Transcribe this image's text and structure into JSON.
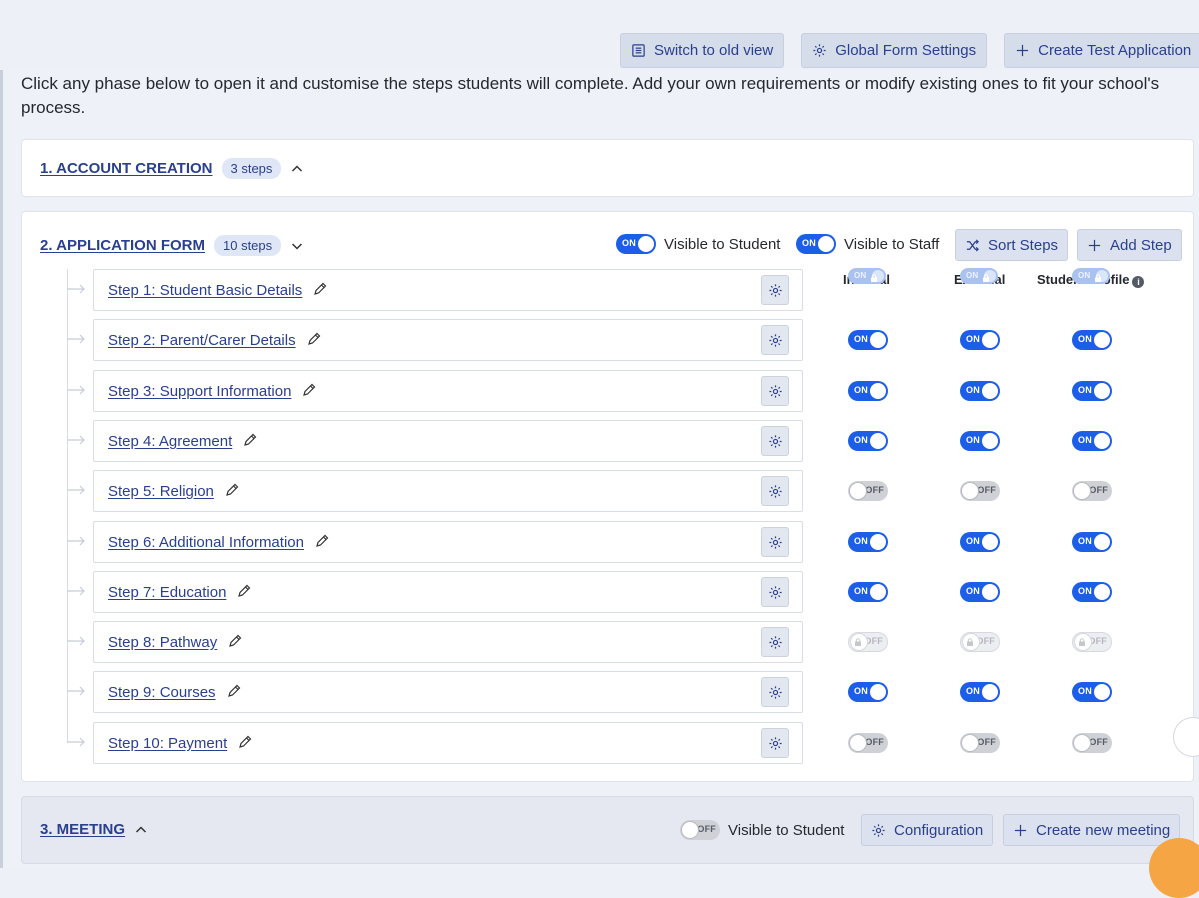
{
  "toolbar": {
    "switch_old_view": "Switch to old view",
    "global_form_settings": "Global Form Settings",
    "create_test_application": "Create Test Application"
  },
  "intro": "Click any phase below to open it and customise the steps students will complete. Add your own requirements or modify existing ones to fit your school's process.",
  "phase1": {
    "title": "1. ACCOUNT CREATION",
    "steps_badge": "3 steps"
  },
  "phase2": {
    "title": "2. APPLICATION FORM",
    "steps_badge": "10 steps",
    "visible_to_student": "Visible to Student",
    "visible_to_student_toggle": "ON",
    "visible_to_staff": "Visible to Staff",
    "visible_to_staff_toggle": "ON",
    "sort_steps": "Sort Steps",
    "add_step": "Add Step",
    "columns": {
      "internal": "Internal",
      "external": "External",
      "student_profile": "Student Profile"
    },
    "steps": [
      {
        "label": "Step 1: Student Basic Details",
        "internal": "ON",
        "external": "ON",
        "profile": "ON",
        "state": "locked"
      },
      {
        "label": "Step 2: Parent/Carer Details",
        "internal": "ON",
        "external": "ON",
        "profile": "ON",
        "state": "on"
      },
      {
        "label": "Step 3: Support Information",
        "internal": "ON",
        "external": "ON",
        "profile": "ON",
        "state": "on"
      },
      {
        "label": "Step 4: Agreement",
        "internal": "ON",
        "external": "ON",
        "profile": "ON",
        "state": "on"
      },
      {
        "label": "Step 5: Religion",
        "internal": "OFF",
        "external": "OFF",
        "profile": "OFF",
        "state": "off"
      },
      {
        "label": "Step 6: Additional Information",
        "internal": "ON",
        "external": "ON",
        "profile": "ON",
        "state": "on"
      },
      {
        "label": "Step 7: Education",
        "internal": "ON",
        "external": "ON",
        "profile": "ON",
        "state": "on"
      },
      {
        "label": "Step 8: Pathway",
        "internal": "OFF",
        "external": "OFF",
        "profile": "OFF",
        "state": "lockedoff"
      },
      {
        "label": "Step 9: Courses",
        "internal": "ON",
        "external": "ON",
        "profile": "ON",
        "state": "on"
      },
      {
        "label": "Step 10: Payment",
        "internal": "OFF",
        "external": "OFF",
        "profile": "OFF",
        "state": "off"
      }
    ]
  },
  "phase3": {
    "title": "3. MEETING",
    "visible_to_student": "Visible to Student",
    "visible_to_student_toggle": "OFF",
    "configuration": "Configuration",
    "create_new_meeting": "Create new meeting"
  },
  "colors": {
    "primary": "#2a3f8f",
    "toggle_on": "#1c5ee8",
    "toggle_off": "#cfd1d6"
  }
}
